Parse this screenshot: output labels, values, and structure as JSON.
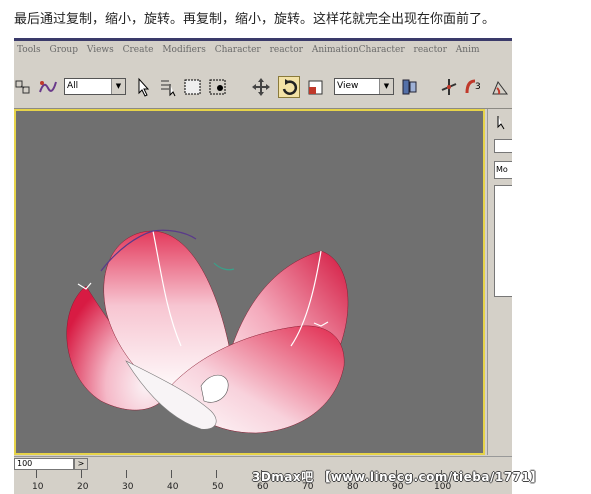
{
  "caption": "最后通过复制，缩小，旋转。再复制，缩小，旋转。这样花就完全出现在你面前了。",
  "app": {
    "menu": [
      "Tools",
      "Group",
      "Views",
      "Create",
      "Modifiers",
      "Character",
      "reactor",
      "AnimationCharacter",
      "reactor",
      "Anim"
    ],
    "toolbar": {
      "selection_filter": "All",
      "reference_coord": "View"
    },
    "side_panel": {
      "field_label": "Mo"
    },
    "timeline": {
      "frame_value": "100",
      "next_label": ">"
    },
    "ruler_labels": [
      "10",
      "20",
      "30",
      "40",
      "50",
      "60",
      "70",
      "80",
      "90",
      "100"
    ]
  },
  "watermark": "3Dmax吧 【www.linecg.com/tieba/1771】",
  "colors": {
    "viewport_bg": "#707070",
    "viewport_border": "#e6d34a",
    "petal_main": "#e5234a",
    "petal_light": "#f7eef2"
  }
}
